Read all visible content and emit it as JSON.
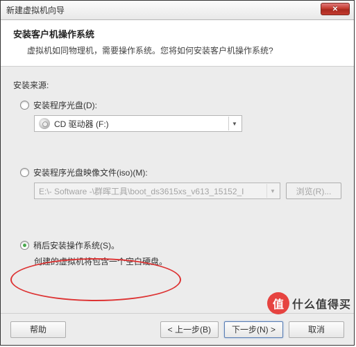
{
  "window": {
    "title": "新建虚拟机向导"
  },
  "header": {
    "title": "安装客户机操作系统",
    "subtitle": "虚拟机如同物理机，需要操作系统。您将如何安装客户机操作系统?"
  },
  "body": {
    "source_label": "安装来源:",
    "opt_disc": {
      "label": "安装程序光盘(D):",
      "combo": "CD 驱动器 (F:)"
    },
    "opt_iso": {
      "label": "安装程序光盘映像文件(iso)(M):",
      "path": "E:\\- Software -\\群晖工具\\boot_ds3615xs_v613_15152_I",
      "browse": "浏览(R)..."
    },
    "opt_later": {
      "label": "稍后安装操作系统(S)。",
      "note": "创建的虚拟机将包含一个空白硬盘。"
    }
  },
  "footer": {
    "help": "帮助",
    "back": "< 上一步(B)",
    "next": "下一步(N) >",
    "cancel": "取消"
  },
  "watermark": {
    "logo": "值",
    "text": "什么值得买"
  }
}
